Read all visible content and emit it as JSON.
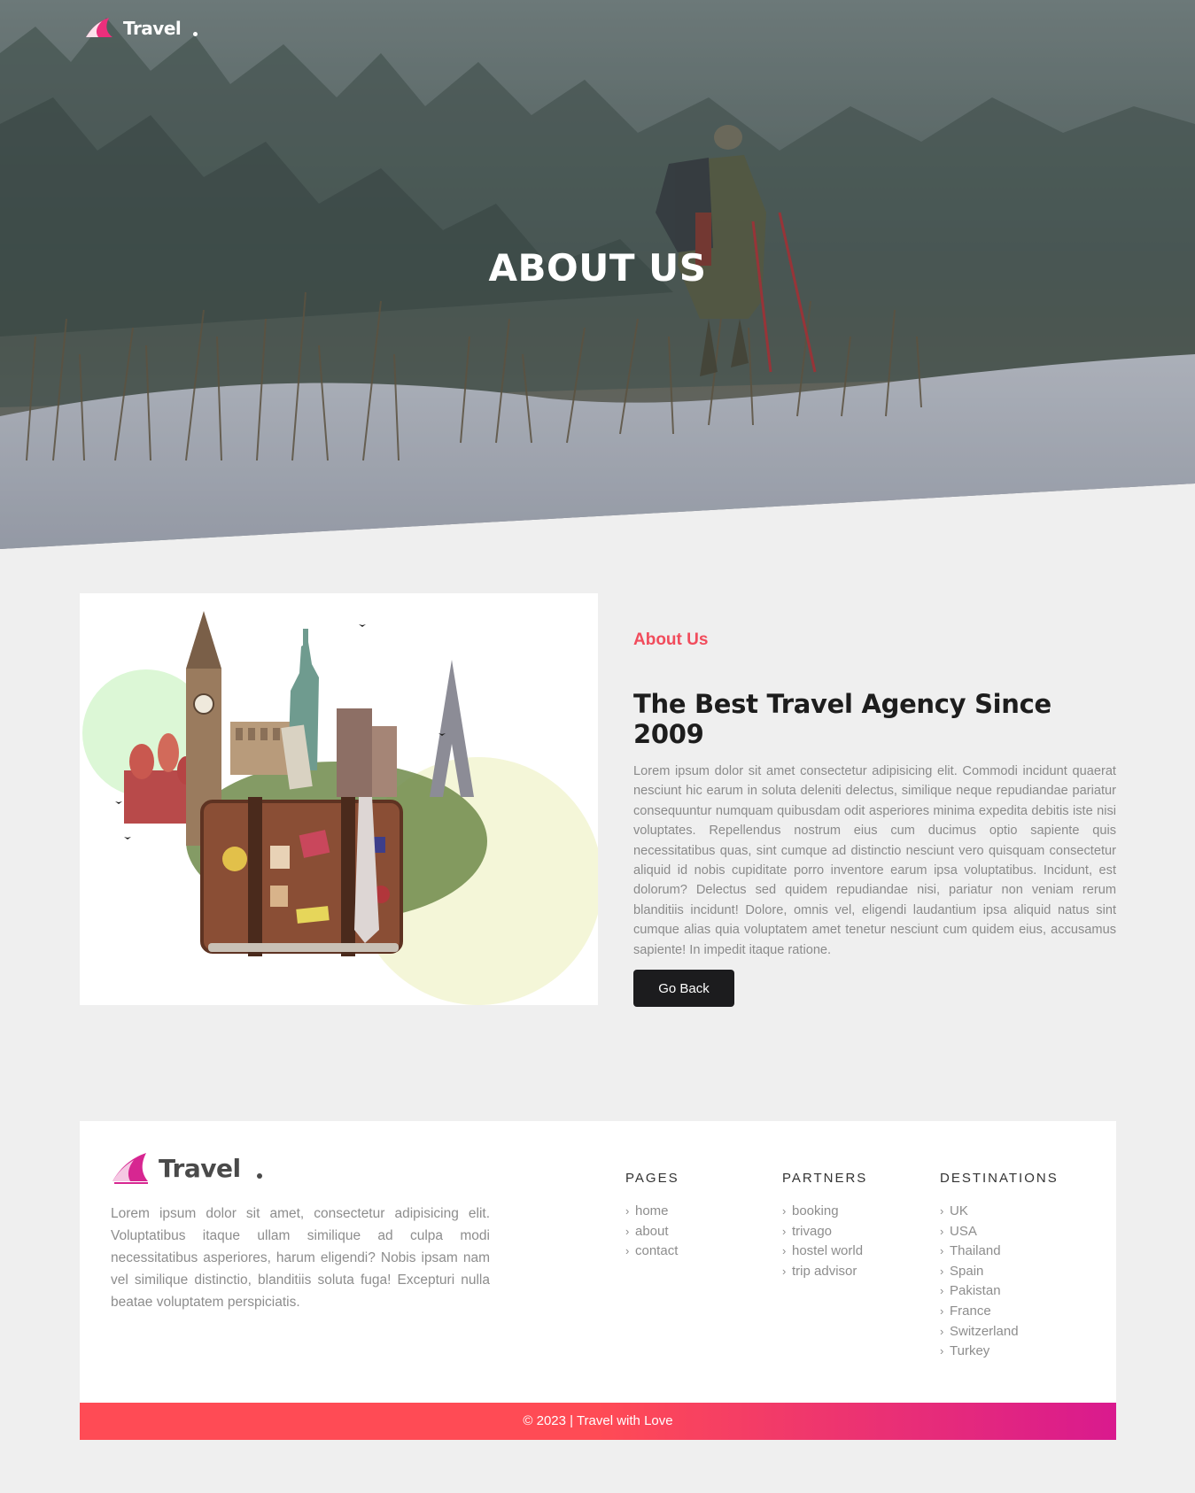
{
  "brand": {
    "name": "Travel",
    "accent": "#f14c5c",
    "accent_2": "#d91a8e"
  },
  "hero": {
    "title": "ABOUT US",
    "image": "hiker-in-snowy-forest"
  },
  "about": {
    "image": "travel-suitcase-with-world-landmarks",
    "eyebrow": "About Us",
    "heading": "The Best Travel Agency Since 2009",
    "paragraph": "Lorem ipsum dolor sit amet consectetur adipisicing elit. Commodi incidunt quaerat nesciunt hic earum in soluta deleniti delectus, similique neque repudiandae pariatur consequuntur numquam quibusdam odit asperiores minima expedita debitis iste nisi voluptates. Repellendus nostrum eius cum ducimus optio sapiente quis necessitatibus quas, sint cumque ad distinctio nesciunt vero quisquam consectetur aliquid id nobis cupiditate porro inventore earum ipsa voluptatibus. Incidunt, est dolorum? Delectus sed quidem repudiandae nisi, pariatur non veniam rerum blanditiis incidunt! Dolore, omnis vel, eligendi laudantium ipsa aliquid natus sint cumque alias quia voluptatem amet tenetur nesciunt cum quidem eius, accusamus sapiente! In impedit itaque ratione.",
    "button": "Go Back"
  },
  "footer": {
    "brand": "Travel",
    "description": "Lorem ipsum dolor sit amet, consectetur adipisicing elit. Voluptatibus itaque ullam similique ad culpa modi necessitatibus asperiores, harum eligendi? Nobis ipsam nam vel similique distinctio, blanditiis soluta fuga! Excepturi nulla beatae voluptatem perspiciatis.",
    "columns": [
      {
        "title": "PAGES",
        "links": [
          "home",
          "about",
          "contact"
        ]
      },
      {
        "title": "PARTNERS",
        "links": [
          "booking",
          "trivago",
          "hostel world",
          "trip advisor"
        ]
      },
      {
        "title": "DESTINATIONS",
        "links": [
          "UK",
          "USA",
          "Thailand",
          "Spain",
          "Pakistan",
          "France",
          "Switzerland",
          "Turkey"
        ]
      }
    ],
    "copyright": "© 2023 | Travel with Love"
  }
}
